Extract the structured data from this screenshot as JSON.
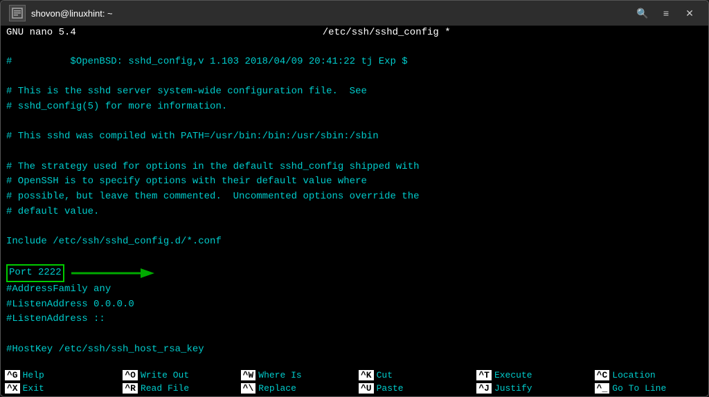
{
  "window": {
    "title": "shovon@linuxhint: ~",
    "icon": "⬛"
  },
  "titlebar": {
    "search_icon": "🔍",
    "menu_icon": "≡",
    "close_icon": "✕"
  },
  "nano": {
    "version_label": "GNU nano 5.4",
    "filename": "/etc/ssh/sshd_config *"
  },
  "editor": {
    "lines": [
      "#          $OpenBSD: sshd_config,v 1.103 2018/04/09 20:41:22 tj Exp $",
      "",
      "# This is the sshd server system-wide configuration file.  See",
      "# sshd_config(5) for more information.",
      "",
      "# This sshd was compiled with PATH=/usr/bin:/bin:/usr/sbin:/sbin",
      "",
      "# The strategy used for options in the default sshd_config shipped with",
      "# OpenSSH is to specify options with their default value where",
      "# possible, but leave them commented.  Uncommented options override the",
      "# default value.",
      "",
      "Include /etc/ssh/sshd_config.d/*.conf",
      "",
      "Port 2222",
      "#AddressFamily any",
      "#ListenAddress 0.0.0.0",
      "#ListenAddress ::",
      "",
      "#HostKey /etc/ssh/ssh_host_rsa_key"
    ],
    "port_line_index": 14,
    "port_text": "Port 2222"
  },
  "bottom_menu": {
    "row1": [
      {
        "key": "^G",
        "label": "Help"
      },
      {
        "key": "^O",
        "label": "Write Out"
      },
      {
        "key": "^W",
        "label": "Where Is"
      },
      {
        "key": "^K",
        "label": "Cut"
      },
      {
        "key": "^T",
        "label": "Execute"
      },
      {
        "key": "^C",
        "label": "Location"
      }
    ],
    "row2": [
      {
        "key": "^X",
        "label": "Exit"
      },
      {
        "key": "^R",
        "label": "Read File"
      },
      {
        "key": "^\\",
        "label": "Replace"
      },
      {
        "key": "^U",
        "label": "Paste"
      },
      {
        "key": "^J",
        "label": "Justify"
      },
      {
        "key": "^_",
        "label": "Go To Line"
      }
    ]
  }
}
